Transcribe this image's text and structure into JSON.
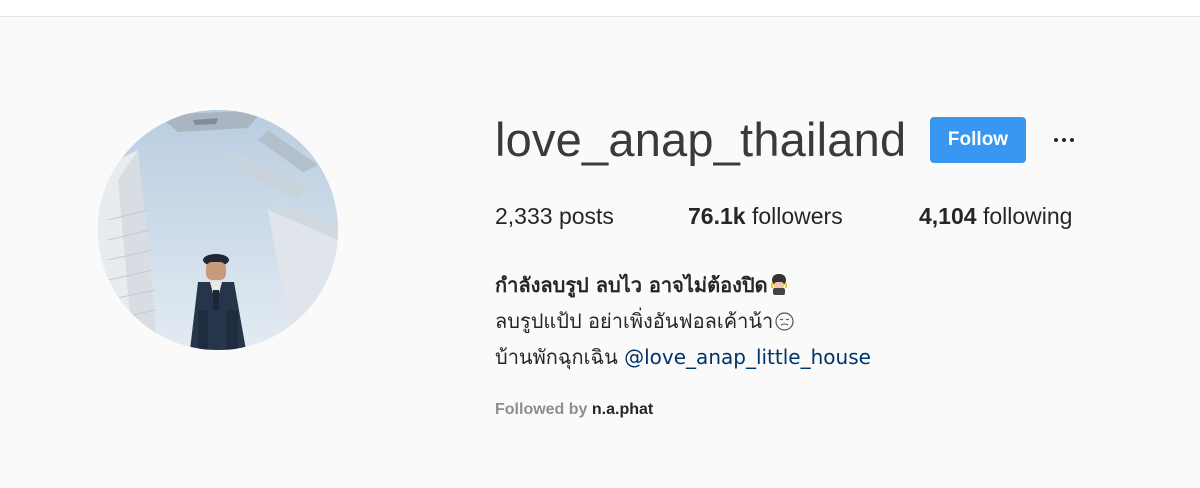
{
  "profile": {
    "username": "love_anap_thailand",
    "follow_label": "Follow",
    "more_icon": "ellipsis-icon"
  },
  "stats": {
    "posts_count": "2,333",
    "posts_label": "posts",
    "followers_count": "76.1k",
    "followers_label": "followers",
    "following_count": "4,104",
    "following_label": "following"
  },
  "bio": {
    "name": "กำลังลบรูป ลบไว อาจไม่ต้องปิด",
    "name_emoji": "guardsman-emoji",
    "line2": "ลบรูปแป้ป อย่าเพิ่งอันฟอลเค้าน้า",
    "line2_emoji": "downcast-face-emoji",
    "line3_prefix": "บ้านพักฉุกเฉิน",
    "line3_mention": "@love_anap_little_house"
  },
  "followed_by": {
    "label": "Followed by",
    "account": "n.a.phat"
  },
  "colors": {
    "background": "#fafafa",
    "follow_button": "#3897f0",
    "mention_link": "#003569"
  }
}
